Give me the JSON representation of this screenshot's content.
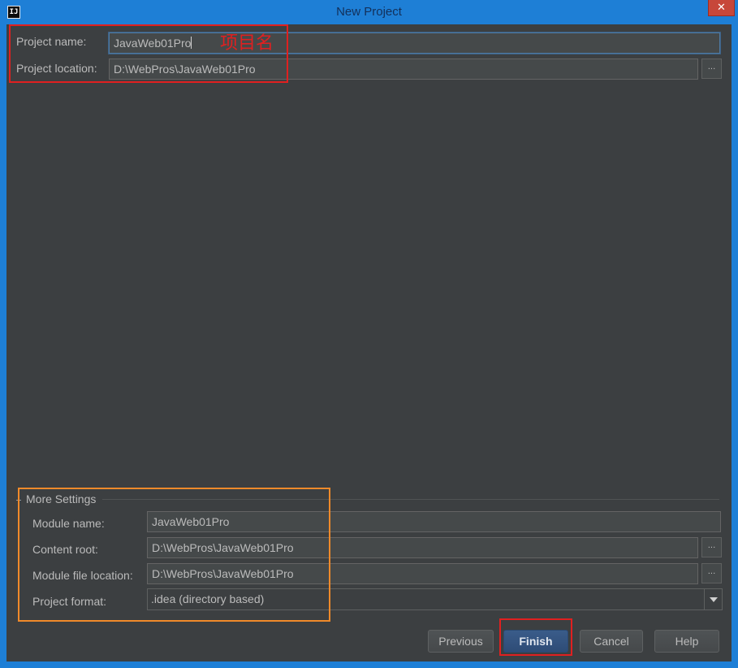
{
  "window": {
    "title": "New Project",
    "app_icon": "IJ",
    "close_label": "✕"
  },
  "project": {
    "name_label": "Project name:",
    "name_value": "JavaWeb01Pro",
    "location_label": "Project location:",
    "location_value": "D:\\WebPros\\JavaWeb01Pro",
    "browse_label": "..."
  },
  "annotations": {
    "project_name_note": "项目名",
    "red_color": "#e02020",
    "orange_color": "#f08a2a"
  },
  "more_settings": {
    "title": "More Settings",
    "module_name_label": "Module name:",
    "module_name_value": "JavaWeb01Pro",
    "content_root_label": "Content root:",
    "content_root_value": "D:\\WebPros\\JavaWeb01Pro",
    "module_file_location_label": "Module file location:",
    "module_file_location_value": "D:\\WebPros\\JavaWeb01Pro",
    "project_format_label": "Project format:",
    "project_format_value": ".idea (directory based)",
    "browse_label": "..."
  },
  "buttons": {
    "previous": "Previous",
    "finish": "Finish",
    "cancel": "Cancel",
    "help": "Help"
  },
  "colors": {
    "window_frame": "#1e7fd6",
    "dialog_background": "#3c3f41",
    "default_button": "#2e4c76"
  }
}
